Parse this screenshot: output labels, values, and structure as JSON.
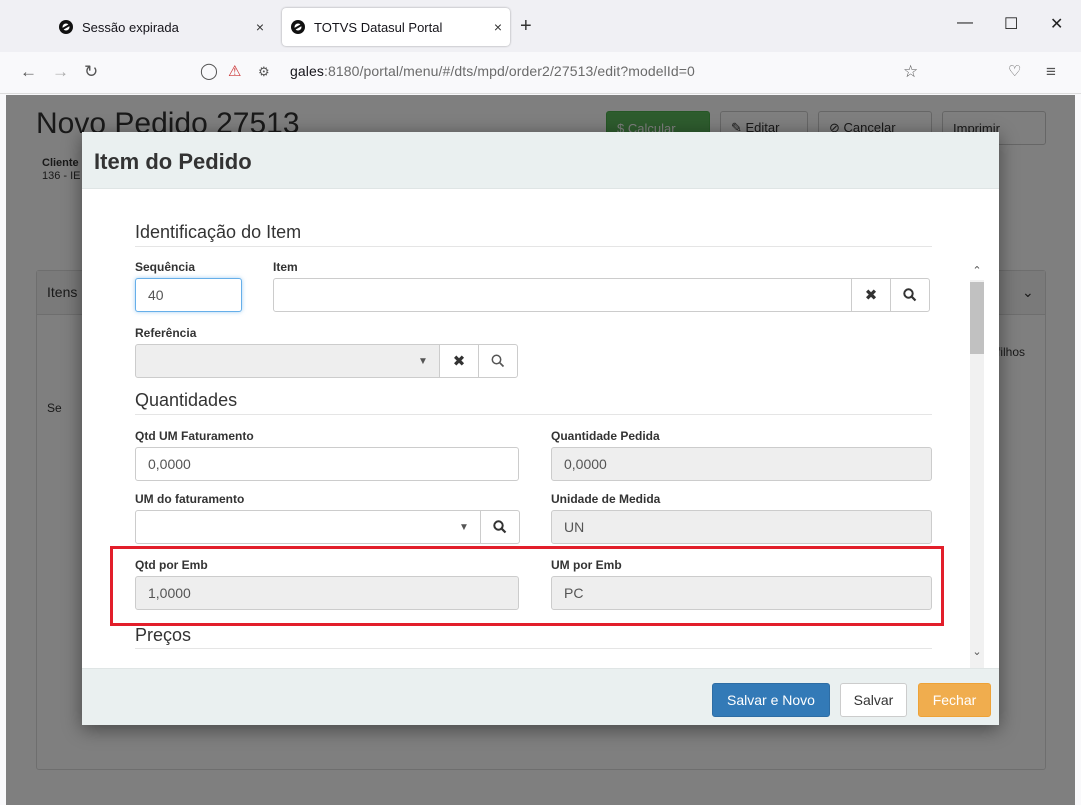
{
  "browser": {
    "tabs": [
      {
        "title": "Sessão expirada",
        "active": false
      },
      {
        "title": "TOTVS Datasul Portal",
        "active": true
      }
    ],
    "url_host": "gales",
    "url_rest": ":8180/portal/menu/#/dts/mpd/order2/27513/edit?modelId=0",
    "new_tab": "+",
    "close_glyph": "×"
  },
  "background_page": {
    "title": "Novo Pedido 27513",
    "buttons": {
      "calcular": "$ Calcular",
      "editar": "✎ Editar",
      "cancelar": "⊘ Cancelar",
      "imprimir": "Imprimir"
    },
    "cliente_label": "Cliente",
    "cliente_value": "136 - IE",
    "itens_label": "Itens",
    "filhos": "filhos",
    "seq_col": "Se"
  },
  "modal": {
    "title": "Item do Pedido",
    "sections": {
      "identificacao": "Identificação do Item",
      "quantidades": "Quantidades",
      "precos": "Preços"
    },
    "fields": {
      "sequencia": {
        "label": "Sequência",
        "value": "40"
      },
      "item": {
        "label": "Item",
        "value": ""
      },
      "referencia": {
        "label": "Referência",
        "value": ""
      },
      "qtd_um_faturamento": {
        "label": "Qtd UM Faturamento",
        "value": "0,0000"
      },
      "quantidade_pedida": {
        "label": "Quantidade Pedida",
        "value": "0,0000"
      },
      "um_faturamento": {
        "label": "UM do faturamento",
        "value": ""
      },
      "unidade_medida": {
        "label": "Unidade de Medida",
        "value": "UN"
      },
      "qtd_por_emb": {
        "label": "Qtd por Emb",
        "value": "1,0000"
      },
      "um_por_emb": {
        "label": "UM por Emb",
        "value": "PC"
      }
    },
    "footer": {
      "salvar_novo": "Salvar e Novo",
      "salvar": "Salvar",
      "fechar": "Fechar"
    }
  },
  "colors": {
    "primary": "#337ab7",
    "warning": "#f0ad4e",
    "success": "#5cb85c",
    "highlight": "#e21e2a",
    "modal_header": "#eaf0f0"
  }
}
